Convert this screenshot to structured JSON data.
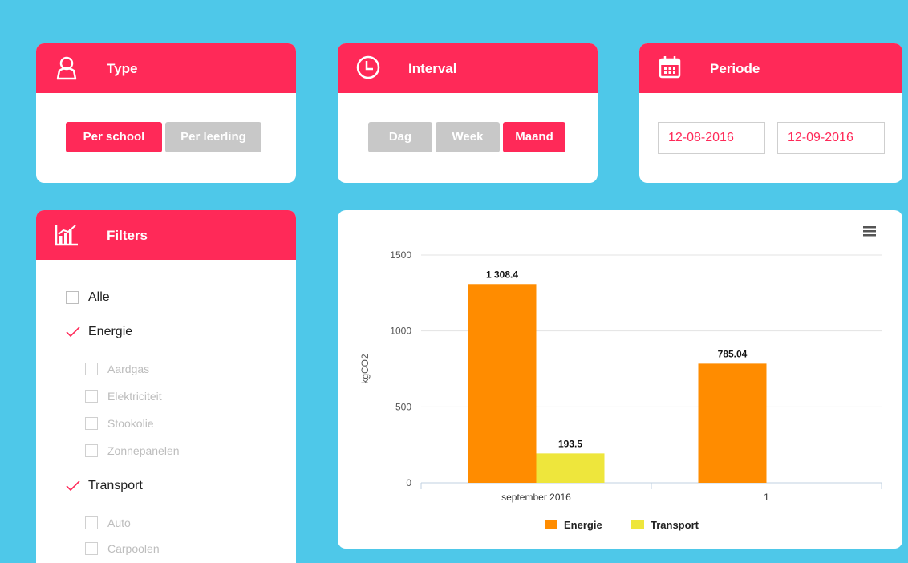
{
  "type_card": {
    "title": "Type",
    "buttons": [
      {
        "label": "Per school",
        "active": true
      },
      {
        "label": "Per leerling",
        "active": false
      }
    ]
  },
  "interval_card": {
    "title": "Interval",
    "buttons": [
      {
        "label": "Dag",
        "active": false
      },
      {
        "label": "Week",
        "active": false
      },
      {
        "label": "Maand",
        "active": true
      }
    ]
  },
  "periode_card": {
    "title": "Periode",
    "start_date": "12-08-2016",
    "end_date": "12-09-2016"
  },
  "filters_card": {
    "title": "Filters",
    "items": [
      {
        "label": "Alle",
        "checked": false
      },
      {
        "label": "Energie",
        "checked": true
      },
      {
        "label": "Aardgas",
        "checked": false,
        "disabled": true
      },
      {
        "label": "Elektriciteit",
        "checked": false,
        "disabled": true
      },
      {
        "label": "Stookolie",
        "checked": false,
        "disabled": true
      },
      {
        "label": "Zonnepanelen",
        "checked": false,
        "disabled": true
      },
      {
        "label": "Transport",
        "checked": true
      },
      {
        "label": "Auto",
        "checked": false,
        "disabled": true
      },
      {
        "label": "Carpoolen",
        "checked": false,
        "disabled": true
      }
    ]
  },
  "colors": {
    "accent": "#ff2958",
    "background": "#4ec8e9",
    "energie": "#ff8c00",
    "transport": "#eee63c"
  },
  "chart_data": {
    "type": "bar",
    "categories": [
      "september 2016",
      "1"
    ],
    "series": [
      {
        "name": "Energie",
        "values": [
          1308.4,
          785.04
        ],
        "labels": [
          "1 308.4",
          "785.04"
        ],
        "color": "#ff8c00"
      },
      {
        "name": "Transport",
        "values": [
          193.5,
          null
        ],
        "labels": [
          "193.5",
          ""
        ],
        "color": "#eee63c"
      }
    ],
    "ylabel": "kgCO2",
    "xlabel": "",
    "ylim": [
      0,
      1500
    ],
    "yticks": [
      0,
      500,
      1000,
      1500
    ],
    "grid": true,
    "legend": "bottom-center"
  }
}
